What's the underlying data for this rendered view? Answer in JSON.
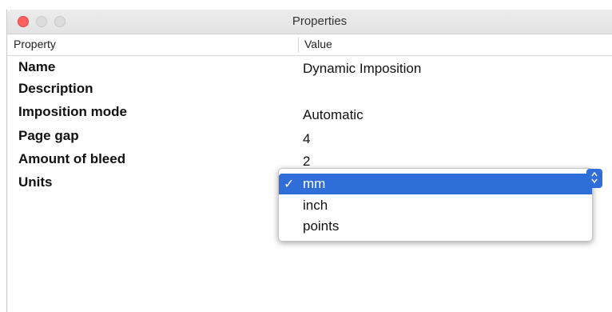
{
  "window": {
    "title": "Properties"
  },
  "table": {
    "headers": {
      "property": "Property",
      "value": "Value"
    },
    "rows": [
      {
        "property": "Name",
        "value": "Dynamic Imposition"
      },
      {
        "property": "Description",
        "value": ""
      },
      {
        "property": "Imposition mode",
        "value": "Automatic"
      },
      {
        "property": "Page gap",
        "value": "4"
      },
      {
        "property": "Amount of bleed",
        "value": "2"
      },
      {
        "property": "Units",
        "value": "mm"
      }
    ]
  },
  "units_dropdown": {
    "options": [
      "mm",
      "inch",
      "points"
    ],
    "selected": "mm",
    "check_glyph": "✓",
    "stepper_icon": "up-down-chevron-icon"
  },
  "colors": {
    "selection": "#2f6ed8",
    "close": "#fc605c"
  }
}
